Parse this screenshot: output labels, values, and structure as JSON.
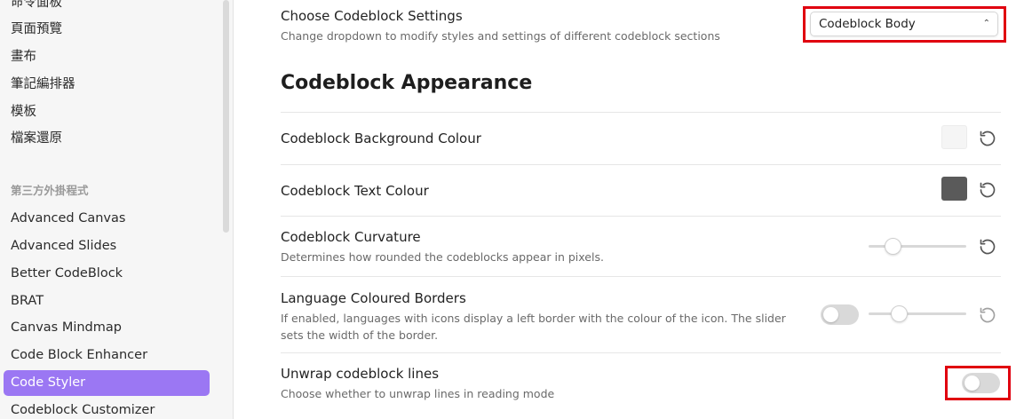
{
  "sidebar": {
    "core_items": [
      {
        "label": "命令面板"
      },
      {
        "label": "頁面預覽"
      },
      {
        "label": "畫布"
      },
      {
        "label": "筆記編排器"
      },
      {
        "label": "模板"
      },
      {
        "label": "檔案還原"
      }
    ],
    "plugins_heading": "第三方外掛程式",
    "plugin_items": [
      {
        "label": "Advanced Canvas",
        "active": false
      },
      {
        "label": "Advanced Slides",
        "active": false
      },
      {
        "label": "Better CodeBlock",
        "active": false
      },
      {
        "label": "BRAT",
        "active": false
      },
      {
        "label": "Canvas Mindmap",
        "active": false
      },
      {
        "label": "Code Block Enhancer",
        "active": false
      },
      {
        "label": "Code Styler",
        "active": true
      },
      {
        "label": "Codeblock Customizer",
        "active": false
      }
    ]
  },
  "settings": {
    "choose": {
      "name": "Choose Codeblock Settings",
      "desc": "Change dropdown to modify styles and settings of different codeblock sections",
      "selected": "Codeblock Body"
    },
    "section_heading": "Codeblock Appearance",
    "background": {
      "name": "Codeblock Background Colour",
      "color": "#f5f5f5"
    },
    "text_colour": {
      "name": "Codeblock Text Colour",
      "color": "#5a5a5a"
    },
    "curvature": {
      "name": "Codeblock Curvature",
      "desc": "Determines how rounded the codeblocks appear in pixels.",
      "slider_fraction": 0.2
    },
    "borders": {
      "name": "Language Coloured Borders",
      "desc": "If enabled, languages with icons display a left border with the colour of the icon. The slider sets the width of the border.",
      "enabled": false,
      "slider_fraction": 0.28
    },
    "unwrap": {
      "name": "Unwrap codeblock lines",
      "desc": "Choose whether to unwrap lines in reading mode",
      "enabled": false
    }
  },
  "colors": {
    "accent": "#9b77f3",
    "highlight_box": "#e0000f"
  },
  "icons": {
    "reset": "reset-icon",
    "dropdown": "chevron-up-down-icon"
  }
}
